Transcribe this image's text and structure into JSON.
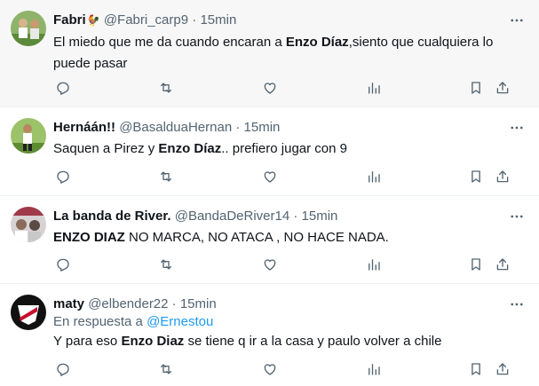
{
  "tweets": [
    {
      "name": "Fabri",
      "emoji": "🐓",
      "handle": "@Fabri_carp9",
      "dot": "·",
      "time": "15min",
      "text_before": "El miedo que me da cuando encaran a ",
      "text_bold": "Enzo Díaz",
      "text_after": ",siento que cualquiera lo puede pasar",
      "avatar_color": "#7aa35a"
    },
    {
      "name": "Hernáán!!",
      "handle": "@BasalduaHernan",
      "dot": "·",
      "time": "15min",
      "text_before": "Saquen a Pirez y ",
      "text_bold": "Enzo Díaz",
      "text_after": ".. prefiero jugar con 9",
      "avatar_color": "#6a8c3e"
    },
    {
      "name": "La banda de River.",
      "handle": "@BandaDeRiver14",
      "dot": "·",
      "time": "15min",
      "text_before": "",
      "text_bold": "ENZO DIAZ",
      "text_after": " NO MARCA, NO ATACA , NO HACE NADA.",
      "avatar_color": "#9a4b5a"
    },
    {
      "name": "maty",
      "handle": "@elbender22",
      "dot": "·",
      "time": "15min",
      "reply_prefix": "En respuesta a ",
      "reply_mention": "@Ernestou",
      "text_before": "Y para eso ",
      "text_bold": "Enzo Diaz",
      "text_after": " se tiene q ir a la casa y paulo volver a chile",
      "avatar_color": "#1a1a1a"
    }
  ],
  "icons": {
    "more": "more-dots-icon",
    "reply": "reply-icon",
    "retweet": "retweet-icon",
    "like": "like-icon",
    "views": "views-icon",
    "bookmark": "bookmark-icon",
    "share": "share-icon"
  },
  "colors": {
    "text": "#0f1419",
    "secondary": "#536471",
    "link": "#1d9bf0",
    "hover_bg": "#f7f7f7",
    "divider": "#eff3f4"
  }
}
